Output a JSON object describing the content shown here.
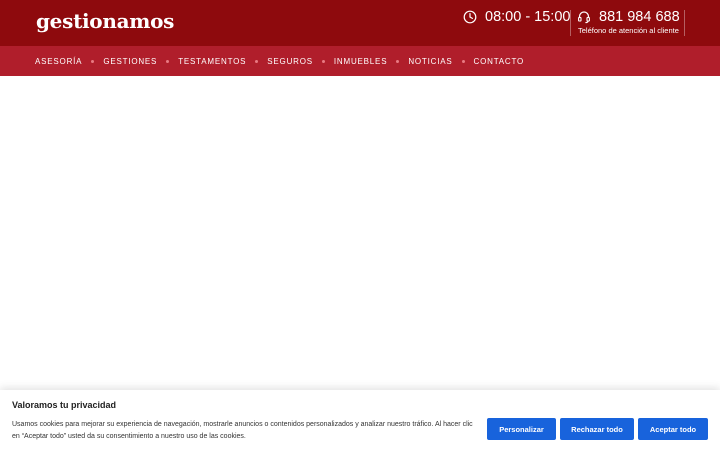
{
  "header": {
    "logo": "gestionamos",
    "hours": "08:00 - 15:00",
    "hours_icon": "clock-icon",
    "phone": "881 984 688",
    "phone_icon": "headset-icon",
    "phone_caption": "Teléfono de atención al cliente"
  },
  "nav": {
    "items": [
      "ASESORÍA",
      "GESTIONES",
      "TESTAMENTOS",
      "SEGUROS",
      "INMUEBLES",
      "NOTICIAS",
      "CONTACTO"
    ]
  },
  "cookie_banner": {
    "title": "Valoramos tu privacidad",
    "text": "Usamos cookies para mejorar su experiencia de navegación, mostrarle anuncios o contenidos personalizados y analizar nuestro tráfico. Al hacer clic en “Aceptar todo” usted da su consentimiento a nuestro uso de las cookies.",
    "buttons": {
      "customize": "Personalizar",
      "reject": "Rechazar todo",
      "accept": "Aceptar todo"
    }
  },
  "colors": {
    "topbar": "#8e0a0d",
    "navbar": "#b01e2b",
    "button": "#1863dc"
  }
}
